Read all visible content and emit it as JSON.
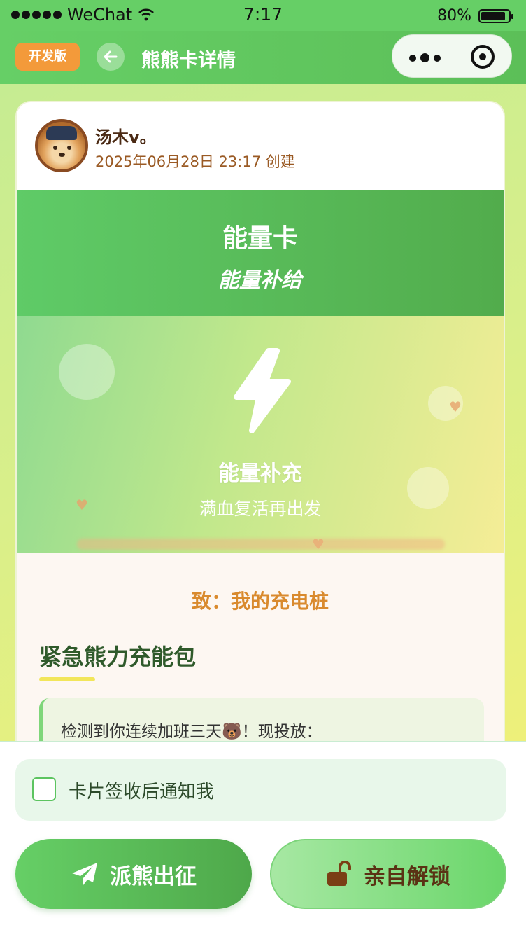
{
  "status_bar": {
    "carrier": "WeChat",
    "time": "7:17",
    "battery": "80%"
  },
  "nav": {
    "dev_tag": "开发版",
    "title": "熊熊卡详情"
  },
  "card": {
    "user_name": "汤木v。",
    "created": "2025年06月28日 23:17 创建",
    "banner_title": "能量卡",
    "banner_subtitle": "能量补给",
    "hero_title": "能量补充",
    "hero_subtitle": "满血复活再出发",
    "to_line": "致：我的充电桩",
    "section_title": "紧急熊力充能包",
    "message": "检测到你连续加班三天🐻！现投放："
  },
  "bottom": {
    "notify_label": "卡片签收后通知我",
    "send_button": "派熊出征",
    "unlock_button": "亲自解锁"
  },
  "colors": {
    "brand_green": "#66cf66",
    "dev_orange": "#f39a3a",
    "accent_orange": "#d98a2e"
  }
}
